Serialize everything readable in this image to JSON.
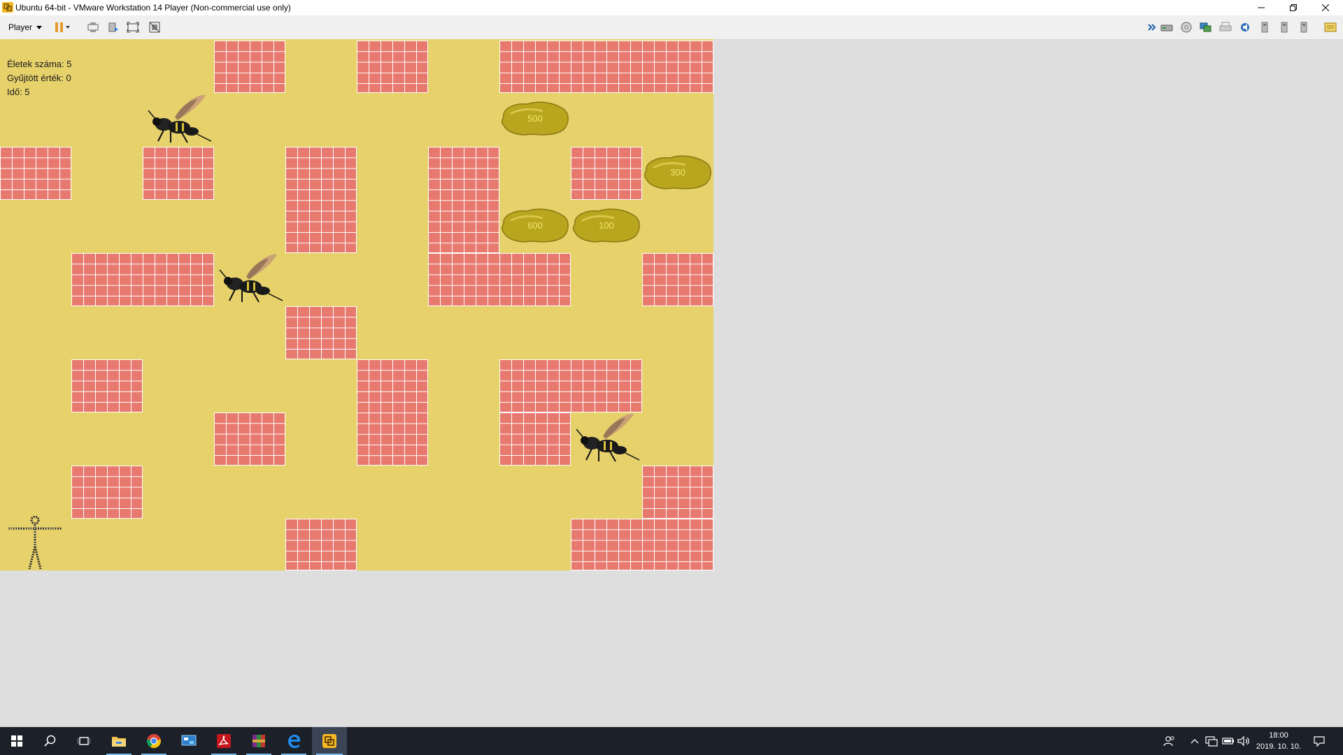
{
  "window": {
    "title": "Ubuntu 64-bit - VMware Workstation 14 Player (Non-commercial use only)",
    "controls": [
      "minimize",
      "restore",
      "close"
    ]
  },
  "toolbar": {
    "player_menu_label": "Player",
    "left_icons": [
      "pause-icon",
      "send-ctrl-alt-del-icon",
      "removable-devices-icon",
      "fullscreen-icon",
      "unity-icon"
    ],
    "right_icons": [
      "expand-icon",
      "hard-disk-icon",
      "cd-dvd-icon",
      "network-adapter-icon",
      "printer-icon",
      "sound-card-icon",
      "usb-device-icon",
      "usb-device-icon",
      "usb-device-icon",
      "message-log-icon"
    ]
  },
  "game": {
    "hud": {
      "lives": "Életek száma: 5",
      "collected": "Gyűjtött érték: 0",
      "time": "Idő: 5"
    },
    "treasures": [
      {
        "value": "500"
      },
      {
        "value": "300"
      },
      {
        "value": "600"
      },
      {
        "value": "100"
      }
    ]
  },
  "taskbar": {
    "apps": [
      "start-icon",
      "search-icon",
      "task-view-icon",
      "file-explorer-icon",
      "chrome-icon",
      "control-panel-icon",
      "acrobat-icon",
      "winrar-icon",
      "edge-icon",
      "vmware-icon"
    ],
    "active_app": "vmware-icon",
    "tray_icons": [
      "people-icon",
      "chevron-up-icon",
      "network-icon",
      "battery-icon",
      "volume-icon"
    ],
    "clock_time": "18:00",
    "clock_date": "2019. 10. 10."
  },
  "colors": {
    "game_background": "#e6d16b",
    "brick": "#e8796f",
    "outside_background": "#dedede",
    "taskbar": "#1b2029"
  }
}
